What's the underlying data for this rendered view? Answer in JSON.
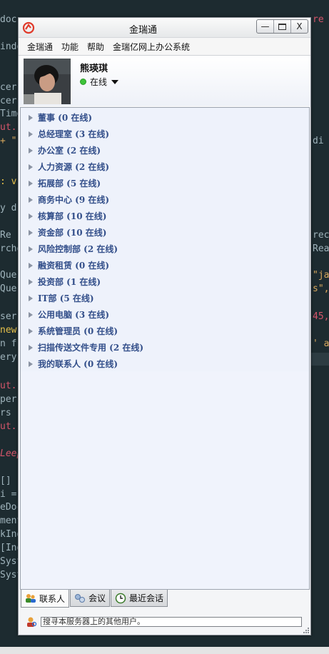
{
  "window": {
    "title": "金瑞通",
    "minimize_label": "—",
    "close_label": "X"
  },
  "menu": [
    "金瑞通",
    "功能",
    "帮助",
    "金瑞亿网上办公系统"
  ],
  "profile": {
    "name": "熊瑛琪",
    "status": "在线",
    "status_color": "#3ec43a"
  },
  "groups": [
    "董事 (0 在线)",
    "总经理室 (3 在线)",
    "办公室 (2 在线)",
    "人力资源 (2 在线)",
    "拓展部 (5 在线)",
    "商务中心 (9 在线)",
    "核算部 (10 在线)",
    "资金部 (10 在线)",
    "风险控制部 (2 在线)",
    "融资租赁 (0 在线)",
    "投资部 (1 在线)",
    "IT部 (5 在线)",
    "公用电脑 (3 在线)",
    "系统管理员 (0 在线)",
    "扫描传送文件专用 (2 在线)",
    "我的联系人 (0 在线)"
  ],
  "tabs": [
    "联系人",
    "会议",
    "最近会话"
  ],
  "search": {
    "placeholder": "搜寻本服务器上的其他用户。"
  },
  "colors": {
    "group_text": "#334f8a",
    "list_background": "#eef2fb",
    "accent_logo": "#e03a2a"
  }
}
